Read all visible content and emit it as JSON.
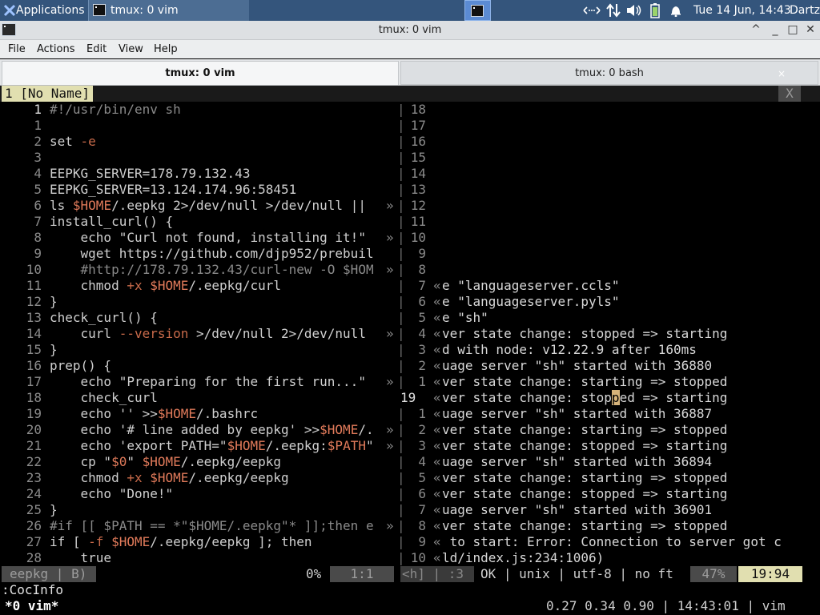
{
  "panel": {
    "apps_label": "Applications",
    "task_label": "tmux: 0 vim",
    "clock": "Tue 14 Jun, 14:43",
    "user": "Dartz",
    "tray_icons": [
      "network-transfer-icon",
      "network-updown-icon",
      "volume-icon",
      "battery-icon",
      "notification-bell-icon"
    ]
  },
  "window": {
    "title": "tmux: 0 vim",
    "buttons": [
      "^",
      "_",
      "□",
      "✕"
    ]
  },
  "menu": {
    "items": [
      "File",
      "Actions",
      "Edit",
      "View",
      "Help"
    ]
  },
  "tabs": [
    {
      "label": "tmux: 0 vim"
    },
    {
      "label": "tmux: 0 bash",
      "close": "×"
    }
  ],
  "vim": {
    "buffer_tab": "1 [No Name]",
    "tab_close": "X",
    "left_lines": [
      {
        "n": "1",
        "text": "#!/usr/bin/env sh"
      },
      {
        "n": "1",
        "text": ""
      },
      {
        "n": "2",
        "text": "set -e"
      },
      {
        "n": "3",
        "text": ""
      },
      {
        "n": "4",
        "text": "EEPKG_SERVER=178.79.132.43"
      },
      {
        "n": "5",
        "text": "EEPKG_SERVER=13.124.174.96:58451"
      },
      {
        "n": "6",
        "text": "ls $HOME/.eepkg 2>/dev/null >/dev/null ||"
      },
      {
        "n": "7",
        "text": "install_curl() {"
      },
      {
        "n": "8",
        "text": "    echo \"Curl not found, installing it!\""
      },
      {
        "n": "9",
        "text": "    wget https://github.com/djp952/prebuil"
      },
      {
        "n": "10",
        "text": "    #http://178.79.132.43/curl-new -O $HOM"
      },
      {
        "n": "11",
        "text": "    chmod +x $HOME/.eepkg/curl"
      },
      {
        "n": "12",
        "text": "}"
      },
      {
        "n": "13",
        "text": "check_curl() {"
      },
      {
        "n": "14",
        "text": "    curl --version >/dev/null 2>/dev/null"
      },
      {
        "n": "15",
        "text": "}"
      },
      {
        "n": "16",
        "text": "prep() {"
      },
      {
        "n": "17",
        "text": "    echo \"Preparing for the first run...\""
      },
      {
        "n": "18",
        "text": "    check_curl"
      },
      {
        "n": "19",
        "text": "    echo '' >>$HOME/.bashrc"
      },
      {
        "n": "20",
        "text": "    echo '# line added by eepkg' >>$HOME/."
      },
      {
        "n": "21",
        "text": "    echo 'export PATH=\"$HOME/.eepkg:$PATH\""
      },
      {
        "n": "22",
        "text": "    cp \"$0\" $HOME/.eepkg/eepkg"
      },
      {
        "n": "23",
        "text": "    chmod +x $HOME/.eepkg/eepkg"
      },
      {
        "n": "24",
        "text": "    echo \"Done!\""
      },
      {
        "n": "25",
        "text": "}"
      },
      {
        "n": "26",
        "text": "#if [[ $PATH == *\"$HOME/.eepkg\"* ]];then e"
      },
      {
        "n": "27",
        "text": "if [ -f $HOME/.eepkg/eepkg ]; then"
      },
      {
        "n": "28",
        "text": "    true"
      }
    ],
    "truncated_rows": [
      6,
      8,
      10,
      14,
      17,
      20,
      21,
      26
    ],
    "right_lines": [
      {
        "n": "18",
        "text": ""
      },
      {
        "n": "17",
        "text": ""
      },
      {
        "n": "16",
        "text": ""
      },
      {
        "n": "15",
        "text": ""
      },
      {
        "n": "14",
        "text": ""
      },
      {
        "n": "13",
        "text": ""
      },
      {
        "n": "12",
        "text": ""
      },
      {
        "n": "11",
        "text": ""
      },
      {
        "n": "10",
        "text": ""
      },
      {
        "n": "9",
        "text": ""
      },
      {
        "n": "8",
        "text": ""
      },
      {
        "n": "7",
        "text": "e \"languageserver.ccls\""
      },
      {
        "n": "6",
        "text": "e \"languageserver.pyls\""
      },
      {
        "n": "5",
        "text": "e \"sh\""
      },
      {
        "n": "4",
        "text": "ver state change: stopped => starting"
      },
      {
        "n": "3",
        "text": "d with node: v12.22.9 after 160ms"
      },
      {
        "n": "2",
        "text": "uage server \"sh\" started with 36880"
      },
      {
        "n": "1",
        "text": "ver state change: starting => stopped"
      },
      {
        "n": "19",
        "text": "ver state change: stopped => starting"
      },
      {
        "n": "1",
        "text": "uage server \"sh\" started with 36887"
      },
      {
        "n": "2",
        "text": "ver state change: starting => stopped"
      },
      {
        "n": "3",
        "text": "ver state change: stopped => starting"
      },
      {
        "n": "4",
        "text": "uage server \"sh\" started with 36894"
      },
      {
        "n": "5",
        "text": "ver state change: starting => stopped"
      },
      {
        "n": "6",
        "text": "ver state change: stopped => starting"
      },
      {
        "n": "7",
        "text": "uage server \"sh\" started with 36901"
      },
      {
        "n": "8",
        "text": "ver state change: starting => stopped"
      },
      {
        "n": "9",
        "text": " to start: Error: Connection to server got c"
      },
      {
        "n": "10",
        "text": "ld/index.js:234:1006)"
      }
    ],
    "right_marker": "«",
    "right_current_row": 18,
    "truncation_marker": "»",
    "separator": "|",
    "statusline": {
      "left_name": "eepkg | B)",
      "left_percent": "0%",
      "left_pos": "1:1",
      "right_hint": "<h] | :3",
      "right_info": "OK | unix | utf-8 | no ft",
      "right_percent": "47%",
      "right_pos": "19:94"
    },
    "command_line": ":CocInfo"
  },
  "tmux": {
    "window_label": "*0 vim*",
    "status_right": "0.27 0.34 0.90 | 14:43:01 | vim"
  },
  "colors": {
    "panel_bg": "#34557c",
    "active_tab_accent": "#e1dfb0",
    "variable": "#e07a5a"
  }
}
